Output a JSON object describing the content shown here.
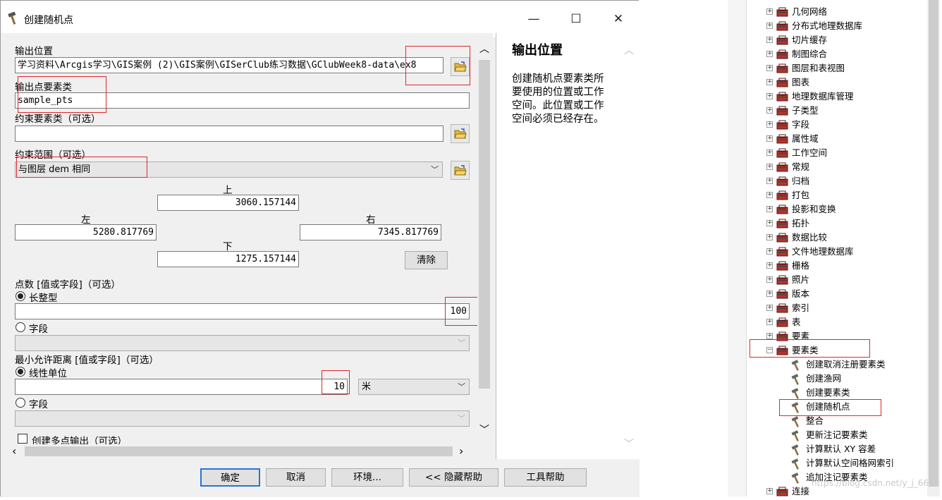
{
  "window": {
    "title": "创建随机点",
    "minimize": "—",
    "maximize": "☐",
    "close": "✕"
  },
  "form": {
    "output_location": {
      "label": "输出位置",
      "value": "学习资料\\Arcgis学习\\GIS案例 (2)\\GIS案例\\GISerClub练习数据\\GClubWeek8-data\\ex8"
    },
    "output_feature_class": {
      "label": "输出点要素类",
      "value": "sample_pts"
    },
    "constraining_feature_class": {
      "label": "约束要素类（可选）",
      "value": ""
    },
    "constraining_extent": {
      "label": "约束范围（可选）",
      "value": "与图层 dem 相同"
    },
    "extent": {
      "top_label": "上",
      "top": "3060.157144",
      "left_label": "左",
      "left": "5280.817769",
      "right_label": "右",
      "right": "7345.817769",
      "bottom_label": "下",
      "bottom": "1275.157144",
      "clear_label": "清除"
    },
    "number_of_points": {
      "label": "点数 [值或字段]（可选）",
      "option_long": "长整型",
      "value": "100",
      "option_field": "字段"
    },
    "min_distance": {
      "label": "最小允许距离 [值或字段]（可选）",
      "option_linear": "线性单位",
      "value": "10",
      "unit": "米",
      "option_field": "字段"
    },
    "multipoint": {
      "label": "创建多点输出（可选）"
    }
  },
  "help": {
    "title": "输出位置",
    "body": "创建随机点要素类所要使用的位置或工作空间。此位置或工作空间必须已经存在。"
  },
  "buttons": {
    "ok": "确定",
    "cancel": "取消",
    "env": "环境...",
    "hide_help": "<< 隐藏帮助",
    "tool_help": "工具帮助"
  },
  "tree": {
    "toolsets": [
      "几何网络",
      "分布式地理数据库",
      "切片缓存",
      "制图综合",
      "图层和表视图",
      "图表",
      "地理数据库管理",
      "子类型",
      "字段",
      "属性域",
      "工作空间",
      "常规",
      "归档",
      "打包",
      "投影和变换",
      "拓扑",
      "数据比较",
      "文件地理数据库",
      "栅格",
      "照片",
      "版本",
      "索引",
      "表",
      "要素",
      "要素类"
    ],
    "tools": [
      "创建取消注册要素类",
      "创建渔网",
      "创建要素类",
      "创建随机点",
      "整合",
      "更新注记要素类",
      "计算默认 XY 容差",
      "计算默认空间格网索引",
      "追加注记要素类"
    ],
    "last": "连接"
  },
  "watermark": "https://blog.csdn.net/y_j_6666"
}
